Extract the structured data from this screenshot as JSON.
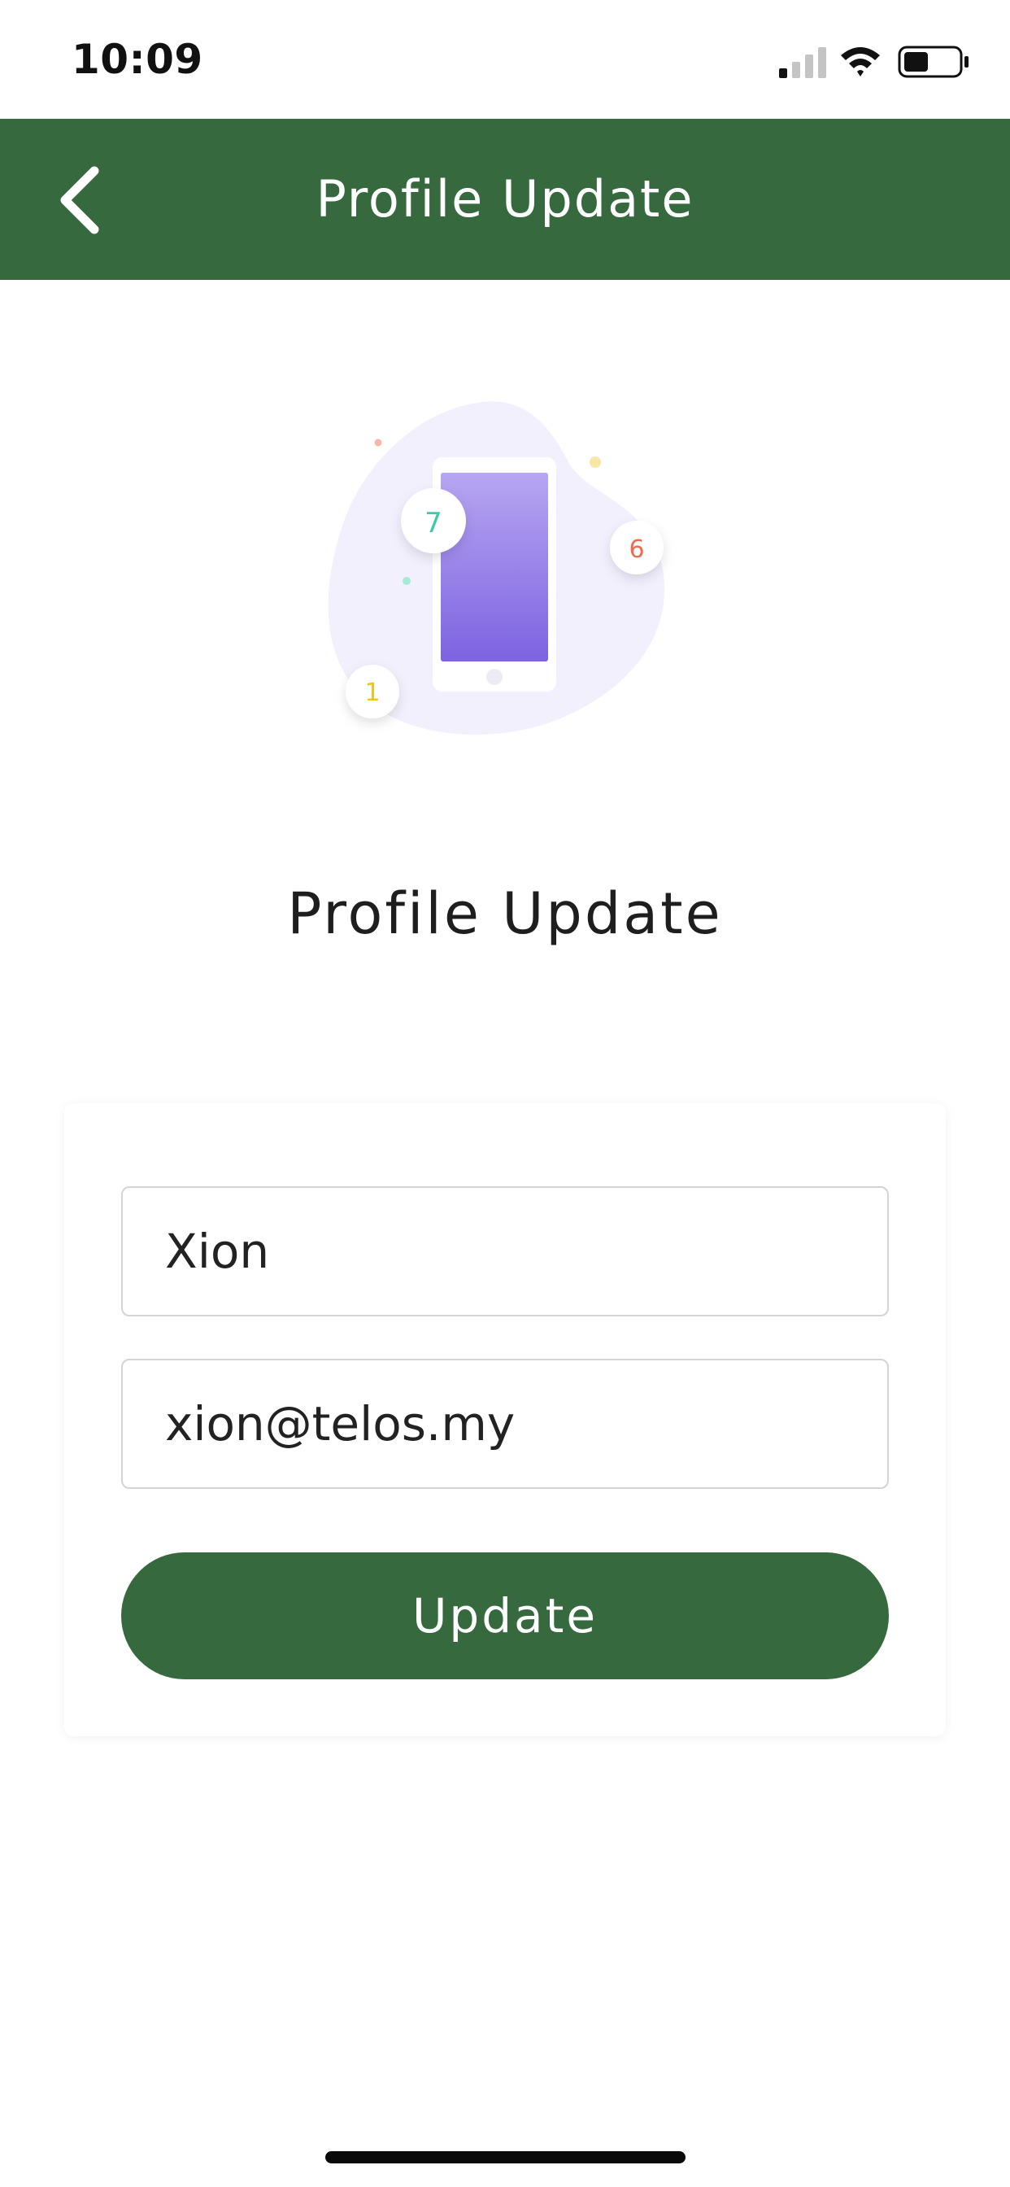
{
  "status_bar": {
    "time": "10:09",
    "icons": [
      "signal-icon",
      "wifi-icon",
      "battery-icon"
    ],
    "battery_level": 0.45
  },
  "nav": {
    "title": "Profile Update",
    "back_icon": "chevron-left-icon"
  },
  "illustration": {
    "badges": [
      "7",
      "6",
      "1"
    ],
    "colors": {
      "blob": "#f2f0fd",
      "phone_screen_top": "#b7a6f2",
      "phone_screen_bottom": "#7d63e0",
      "badge_7": "#3ec9a7",
      "badge_6": "#ee6b4d",
      "badge_1": "#f0c419"
    }
  },
  "page": {
    "title": "Profile Update"
  },
  "form": {
    "name_value": "Xion",
    "email_value": "xion@telos.my",
    "submit_label": "Update"
  },
  "colors": {
    "brand": "#36693d",
    "background": "#ffffff",
    "input_border": "#d4d4d4"
  }
}
